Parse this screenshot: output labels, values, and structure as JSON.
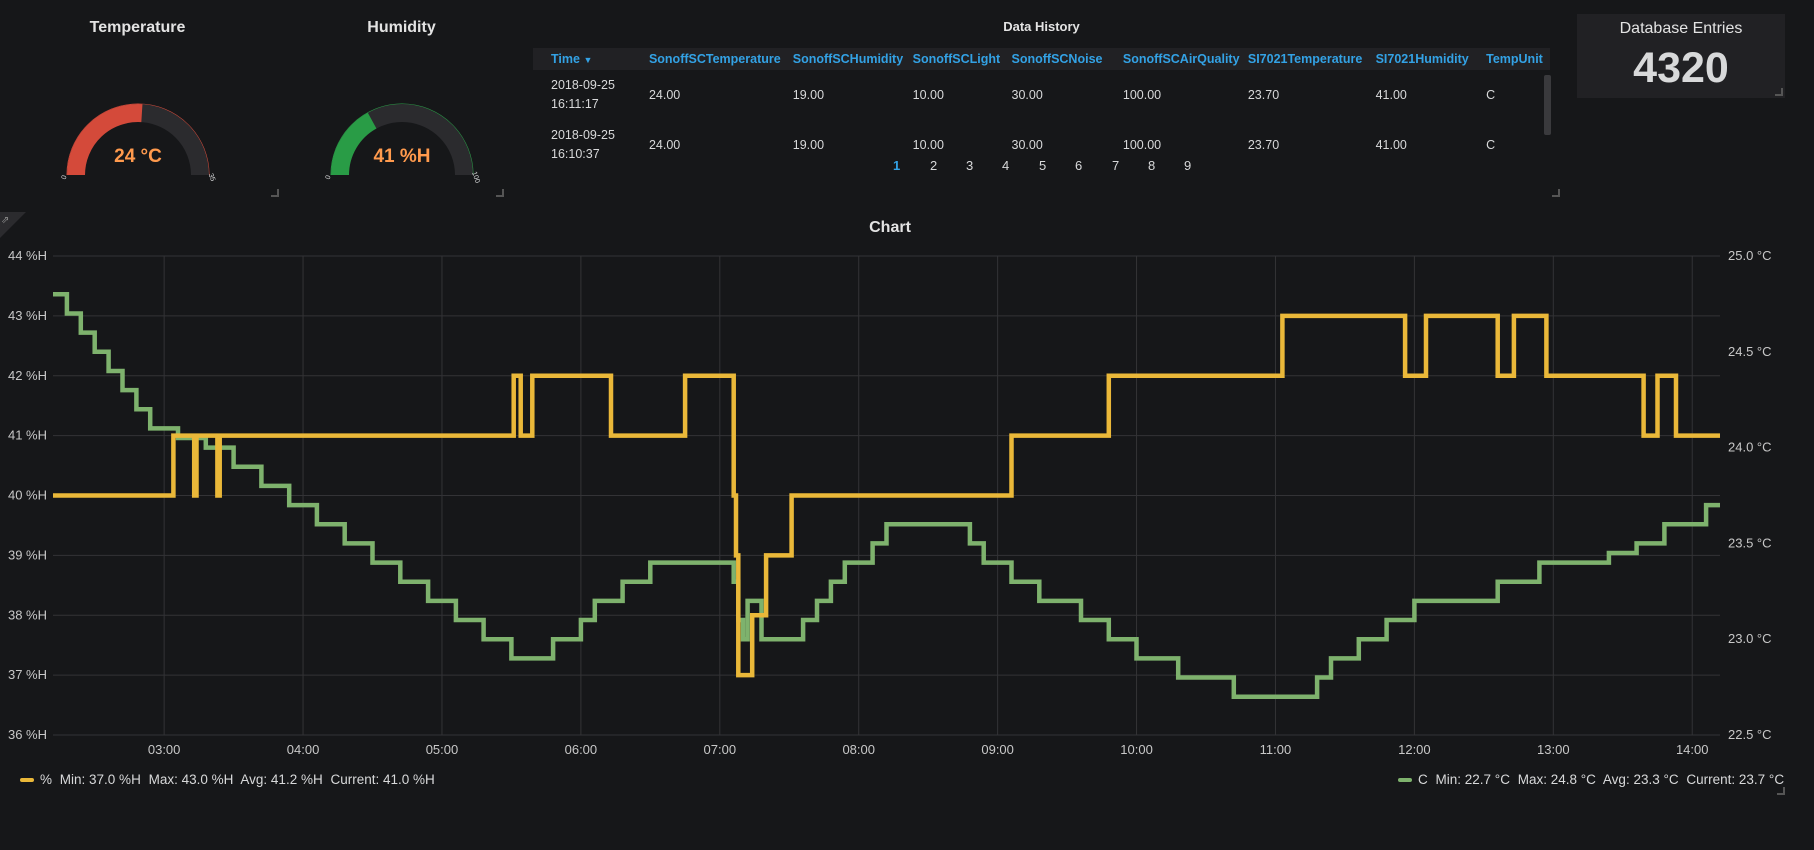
{
  "colors": {
    "humidity": "#eab839",
    "temperature": "#7eb26d",
    "gauge_temp": "#d44a3a",
    "gauge_hum": "#299c46",
    "value_text": "#ff9a4d",
    "link": "#33a2e5"
  },
  "temperature_panel": {
    "title": "Temperature",
    "value": "24 °C",
    "min_label": "0",
    "max_label": "35",
    "fraction": 0.52
  },
  "humidity_panel": {
    "title": "Humidity",
    "value": "41 %H",
    "min_label": "0",
    "max_label": "100",
    "fraction": 0.34
  },
  "history": {
    "title": "Data History",
    "sort_icon": "caret-down-icon",
    "columns": [
      "Time",
      "SonoffSCTemperature",
      "SonoffSCHumidity",
      "SonoffSCLight",
      "SonoffSCNoise",
      "SonoffSCAirQuality",
      "SI7021Temperature",
      "SI7021Humidity",
      "TempUnit"
    ],
    "rows": [
      {
        "time_date": "2018-09-25",
        "time_clock": "16:11:17",
        "cells": [
          "24.00",
          "19.00",
          "10.00",
          "30.00",
          "100.00",
          "23.70",
          "41.00",
          "C"
        ]
      },
      {
        "time_date": "2018-09-25",
        "time_clock": "16:10:37",
        "cells": [
          "24.00",
          "19.00",
          "10.00",
          "30.00",
          "100.00",
          "23.70",
          "41.00",
          "C"
        ]
      }
    ],
    "pages": [
      "1",
      "2",
      "3",
      "4",
      "5",
      "6",
      "7",
      "8",
      "9"
    ],
    "current_page": "1"
  },
  "database": {
    "title": "Database Entries",
    "value": "4320"
  },
  "chart": {
    "title": "Chart",
    "share_icon": "external-link-icon"
  },
  "legend_left": {
    "name": "%",
    "min": "Min: 37.0 %H",
    "max": "Max: 43.0 %H",
    "avg": "Avg: 41.2 %H",
    "current": "Current: 41.0 %H"
  },
  "legend_right": {
    "name": "C",
    "min": "Min: 22.7 °C",
    "max": "Max: 24.8 °C",
    "avg": "Avg: 23.3 °C",
    "current": "Current: 23.7 °C"
  },
  "chart_data": {
    "type": "line",
    "title": "Chart",
    "x_ticks": [
      "03:00",
      "04:00",
      "05:00",
      "06:00",
      "07:00",
      "08:00",
      "09:00",
      "10:00",
      "11:00",
      "12:00",
      "13:00",
      "14:00"
    ],
    "xlim": [
      "02:12",
      "14:12"
    ],
    "y_left": {
      "ticks": [
        "36 %H",
        "37 %H",
        "38 %H",
        "39 %H",
        "40 %H",
        "41 %H",
        "42 %H",
        "43 %H",
        "44 %H"
      ],
      "ylim": [
        36,
        44
      ]
    },
    "y_right": {
      "ticks": [
        "22.5 °C",
        "23.0 °C",
        "23.5 °C",
        "24.0 °C",
        "24.5 °C",
        "25.0 °C"
      ],
      "ylim": [
        22.5,
        25.0
      ]
    },
    "grid": true,
    "legend_position": "bottom",
    "series": [
      {
        "name": "%",
        "axis": "left",
        "points": [
          [
            "02:12",
            40
          ],
          [
            "03:03",
            40
          ],
          [
            "03:04",
            41
          ],
          [
            "03:12",
            41
          ],
          [
            "03:13",
            40
          ],
          [
            "03:14",
            41
          ],
          [
            "03:22",
            41
          ],
          [
            "03:23",
            40
          ],
          [
            "03:24",
            41
          ],
          [
            "05:30",
            41
          ],
          [
            "05:31",
            42
          ],
          [
            "05:34",
            41
          ],
          [
            "05:38",
            41
          ],
          [
            "05:39",
            42
          ],
          [
            "06:12",
            42
          ],
          [
            "06:13",
            41
          ],
          [
            "06:44",
            41
          ],
          [
            "06:45",
            42
          ],
          [
            "07:05",
            42
          ],
          [
            "07:06",
            40
          ],
          [
            "07:07",
            39
          ],
          [
            "07:08",
            37
          ],
          [
            "07:13",
            37
          ],
          [
            "07:14",
            38
          ],
          [
            "07:19",
            38
          ],
          [
            "07:20",
            39
          ],
          [
            "07:30",
            39
          ],
          [
            "07:31",
            40
          ],
          [
            "09:05",
            40
          ],
          [
            "09:06",
            41
          ],
          [
            "09:47",
            41
          ],
          [
            "09:48",
            42
          ],
          [
            "11:02",
            42
          ],
          [
            "11:03",
            43
          ],
          [
            "11:55",
            43
          ],
          [
            "11:56",
            42
          ],
          [
            "12:04",
            42
          ],
          [
            "12:05",
            43
          ],
          [
            "12:35",
            43
          ],
          [
            "12:36",
            42
          ],
          [
            "12:42",
            42
          ],
          [
            "12:43",
            43
          ],
          [
            "12:56",
            43
          ],
          [
            "12:57",
            42
          ],
          [
            "13:38",
            42
          ],
          [
            "13:39",
            41
          ],
          [
            "13:44",
            41
          ],
          [
            "13:45",
            42
          ],
          [
            "13:52",
            42
          ],
          [
            "13:53",
            41
          ],
          [
            "14:12",
            41
          ]
        ]
      },
      {
        "name": "C",
        "axis": "right",
        "points": [
          [
            "02:12",
            24.8
          ],
          [
            "02:18",
            24.7
          ],
          [
            "02:24",
            24.6
          ],
          [
            "02:30",
            24.5
          ],
          [
            "02:36",
            24.4
          ],
          [
            "02:42",
            24.3
          ],
          [
            "02:48",
            24.2
          ],
          [
            "02:54",
            24.1
          ],
          [
            "03:06",
            24.05
          ],
          [
            "03:18",
            24.0
          ],
          [
            "03:30",
            23.9
          ],
          [
            "03:42",
            23.8
          ],
          [
            "03:54",
            23.7
          ],
          [
            "04:06",
            23.6
          ],
          [
            "04:18",
            23.5
          ],
          [
            "04:30",
            23.4
          ],
          [
            "04:42",
            23.3
          ],
          [
            "04:54",
            23.2
          ],
          [
            "05:06",
            23.1
          ],
          [
            "05:18",
            23.0
          ],
          [
            "05:30",
            22.9
          ],
          [
            "05:48",
            23.0
          ],
          [
            "06:00",
            23.1
          ],
          [
            "06:06",
            23.2
          ],
          [
            "06:18",
            23.3
          ],
          [
            "06:30",
            23.4
          ],
          [
            "07:06",
            23.3
          ],
          [
            "07:08",
            23.1
          ],
          [
            "07:10",
            23.0
          ],
          [
            "07:12",
            23.2
          ],
          [
            "07:18",
            23.0
          ],
          [
            "07:36",
            23.1
          ],
          [
            "07:42",
            23.2
          ],
          [
            "07:48",
            23.3
          ],
          [
            "07:54",
            23.4
          ],
          [
            "08:06",
            23.5
          ],
          [
            "08:12",
            23.6
          ],
          [
            "08:48",
            23.5
          ],
          [
            "08:54",
            23.4
          ],
          [
            "09:06",
            23.3
          ],
          [
            "09:18",
            23.2
          ],
          [
            "09:36",
            23.1
          ],
          [
            "09:48",
            23.0
          ],
          [
            "10:00",
            22.9
          ],
          [
            "10:18",
            22.8
          ],
          [
            "10:42",
            22.7
          ],
          [
            "11:18",
            22.8
          ],
          [
            "11:24",
            22.9
          ],
          [
            "11:36",
            23.0
          ],
          [
            "11:48",
            23.1
          ],
          [
            "12:00",
            23.2
          ],
          [
            "12:36",
            23.3
          ],
          [
            "12:54",
            23.4
          ],
          [
            "13:24",
            23.45
          ],
          [
            "13:36",
            23.5
          ],
          [
            "13:48",
            23.6
          ],
          [
            "14:06",
            23.7
          ],
          [
            "14:12",
            23.7
          ]
        ]
      }
    ]
  }
}
